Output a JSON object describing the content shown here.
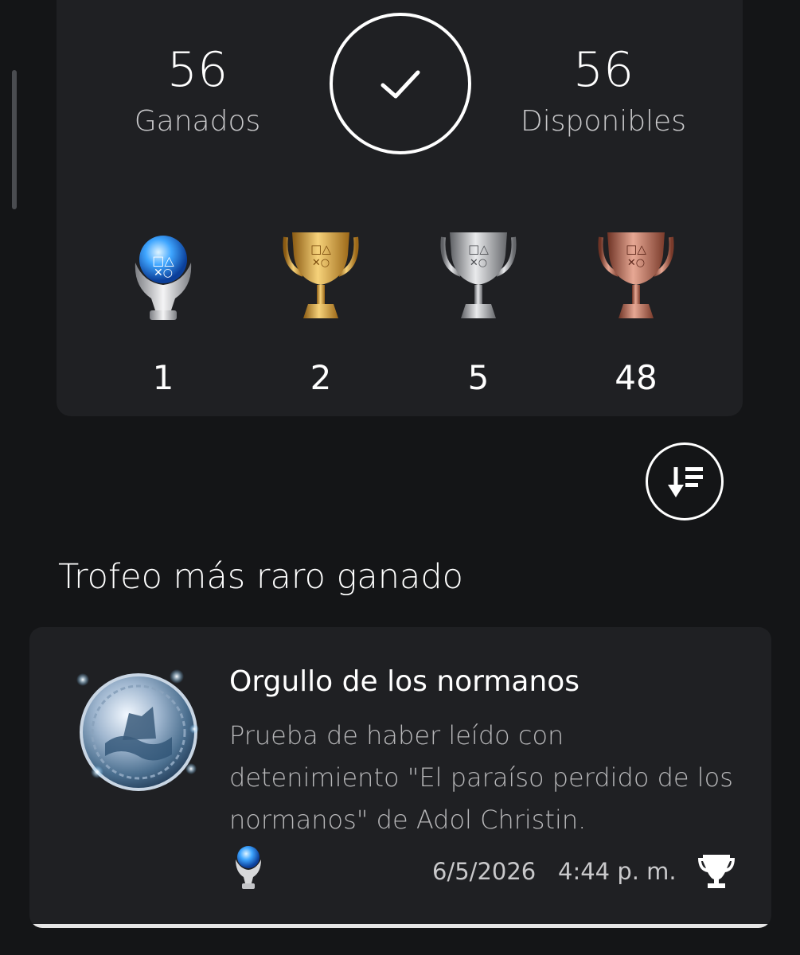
{
  "summary": {
    "earned_count": "56",
    "earned_label": "Ganados",
    "available_count": "56",
    "available_label": "Disponibles",
    "completed_icon": "check-icon",
    "trophies": [
      {
        "type": "platinum",
        "count": "1",
        "icon": "platinum-trophy-icon",
        "color": "#8fd3ff"
      },
      {
        "type": "gold",
        "count": "2",
        "icon": "gold-trophy-icon",
        "color": "#d9a440"
      },
      {
        "type": "silver",
        "count": "5",
        "icon": "silver-trophy-icon",
        "color": "#c8c8c8"
      },
      {
        "type": "bronze",
        "count": "48",
        "icon": "bronze-trophy-icon",
        "color": "#c9826a"
      }
    ]
  },
  "sort_button": {
    "icon": "sort-descending-icon"
  },
  "rarest": {
    "section_title": "Trofeo más raro ganado",
    "trophy_name": "Orgullo de los normanos",
    "description": "Prueba de haber leído con detenimiento \"El paraíso perdido de los normanos\" de Adol Christin.",
    "date": "6/5/2026",
    "time": "4:44 p. m.",
    "grade_icon": "platinum-trophy-small-icon",
    "earned_icon": "trophy-cup-icon"
  },
  "colors": {
    "background": "#141517",
    "card": "#1f2023",
    "text_primary": "#ffffff",
    "text_secondary": "#c9c9cb"
  }
}
